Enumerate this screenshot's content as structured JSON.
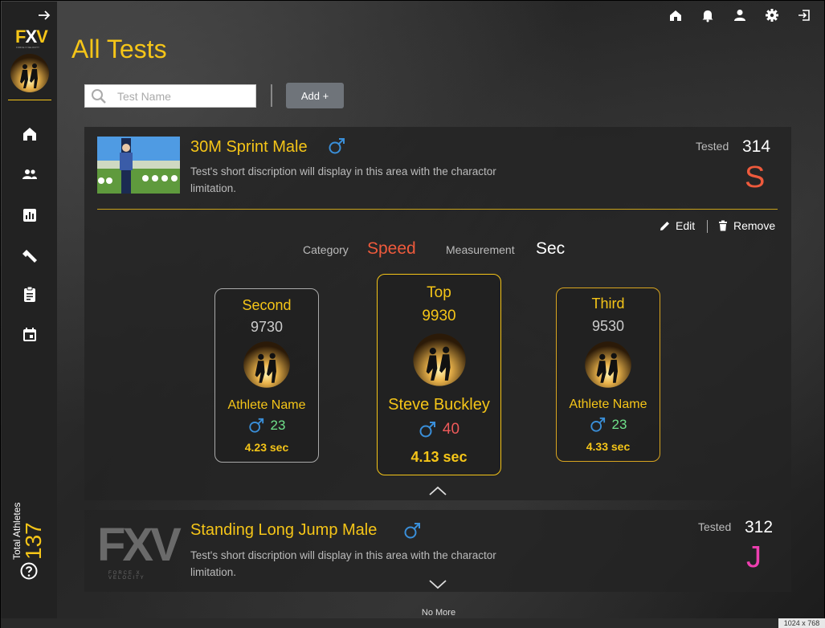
{
  "app": {
    "logo_text_a": "F",
    "logo_text_b": "X",
    "logo_text_c": "V",
    "logo_sub": "FORCE X VELOCITY"
  },
  "page": {
    "title": "All Tests",
    "no_more": "No More",
    "resolution": "1024 x 768"
  },
  "search": {
    "placeholder": "Test Name",
    "value": ""
  },
  "toolbar": {
    "add_label": "Add +"
  },
  "sidebar": {
    "total_label": "Total Athletes",
    "total_value": "137",
    "items": [
      "home-icon",
      "team-icon",
      "chart-icon",
      "fitness-icon",
      "clipboard-icon",
      "calendar-icon"
    ]
  },
  "topbar": {
    "icons": [
      "home-icon",
      "bell-icon",
      "person-icon",
      "gear-icon",
      "logout-icon"
    ]
  },
  "tests": [
    {
      "title": "30M Sprint Male",
      "description": "Test's short discription will display in this area with the charactor limitation.",
      "tested_label": "Tested",
      "tested_value": "314",
      "letter": "S",
      "letter_color": "#ee5a3c",
      "edit_label": "Edit",
      "remove_label": "Remove",
      "category_label": "Category",
      "category_value": "Speed",
      "measurement_label": "Measurement",
      "measurement_value": "Sec",
      "podium": {
        "second": {
          "rank": "Second",
          "score": "9730",
          "name": "Athlete Name",
          "age": "23",
          "time": "4.23 sec"
        },
        "top": {
          "rank": "Top",
          "score": "9930",
          "name": "Steve Buckley",
          "age": "40",
          "time": "4.13 sec"
        },
        "third": {
          "rank": "Third",
          "score": "9530",
          "name": "Athlete Name",
          "age": "23",
          "time": "4.33 sec"
        }
      }
    },
    {
      "title": "Standing Long Jump Male",
      "description": "Test's short discription will display in this area with the charactor limitation.",
      "tested_label": "Tested",
      "tested_value": "312",
      "letter": "J",
      "letter_color": "#ee3fb0",
      "logo_big": "FXV",
      "logo_small": "FORCE X VELOCITY"
    }
  ],
  "colors": {
    "accent": "#f5c518",
    "male": "#3a8fd9",
    "age_green": "#6fe08a",
    "age_red": "#ee5a5a",
    "speed": "#ee5a3c"
  }
}
